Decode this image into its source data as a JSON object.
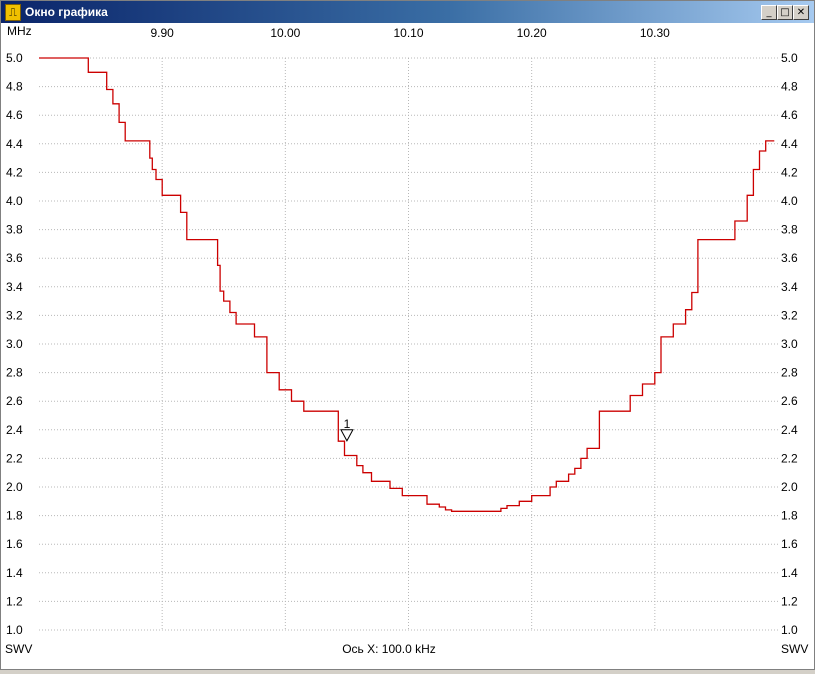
{
  "window": {
    "title": "Окно графика",
    "icon": "chart-window-icon",
    "controls": [
      "minimize",
      "maximize",
      "close"
    ]
  },
  "chart_data": {
    "type": "line",
    "title": "",
    "x_unit_label": "MHz",
    "x_ticks": [
      "9.90",
      "10.00",
      "10.10",
      "10.20",
      "10.30"
    ],
    "x_tick_values": [
      9.9,
      10.0,
      10.1,
      10.2,
      10.3
    ],
    "xlim": [
      9.8,
      10.4
    ],
    "xlabel": "Ось X: 100.0 kHz",
    "ylabel_left": "SWV",
    "ylabel_right": "SWV",
    "ylim": [
      1.0,
      5.0
    ],
    "y_ticks": [
      "5.0",
      "4.8",
      "4.6",
      "4.4",
      "4.2",
      "4.0",
      "3.8",
      "3.6",
      "3.4",
      "3.2",
      "3.0",
      "2.8",
      "2.6",
      "2.4",
      "2.2",
      "2.0",
      "1.8",
      "1.6",
      "1.4",
      "1.2",
      "1.0"
    ],
    "grid": true,
    "line_color": "#cc0000",
    "marker": {
      "label": "1",
      "x": 10.05,
      "y": 2.4
    },
    "series": [
      {
        "x": [
          9.8,
          9.84,
          9.84,
          9.855,
          9.855,
          9.86,
          9.86,
          9.865,
          9.865,
          9.87,
          9.87,
          9.875,
          9.875,
          9.88,
          9.88,
          9.89,
          9.89,
          9.892,
          9.892,
          9.895,
          9.895,
          9.9,
          9.9,
          9.915,
          9.915,
          9.92,
          9.92,
          9.925,
          9.925,
          9.945,
          9.945,
          9.947,
          9.947,
          9.95,
          9.95,
          9.955,
          9.955,
          9.96,
          9.96,
          9.965,
          9.965,
          9.975,
          9.975,
          9.985,
          9.985,
          9.995,
          9.995,
          10.005,
          10.005,
          10.015,
          10.015,
          10.025,
          10.025,
          10.043,
          10.043,
          10.048,
          10.048,
          10.058,
          10.058,
          10.063,
          10.063,
          10.07,
          10.07,
          10.085,
          10.085,
          10.095,
          10.095,
          10.098,
          10.098,
          10.115,
          10.115,
          10.125,
          10.125,
          10.13,
          10.13,
          10.135,
          10.135,
          10.175,
          10.175,
          10.18,
          10.18,
          10.19,
          10.19,
          10.2,
          10.2,
          10.215,
          10.215,
          10.22,
          10.22,
          10.23,
          10.23,
          10.235,
          10.235,
          10.24,
          10.24,
          10.245,
          10.245,
          10.255,
          10.255,
          10.275,
          10.275,
          10.28,
          10.28,
          10.29,
          10.29,
          10.3,
          10.3,
          10.305,
          10.305,
          10.315,
          10.315,
          10.325,
          10.325,
          10.33,
          10.33,
          10.335,
          10.335,
          10.36,
          10.36,
          10.365,
          10.365,
          10.375,
          10.375,
          10.38,
          10.38,
          10.385,
          10.385,
          10.39,
          10.39,
          10.397
        ],
        "y": [
          5.0,
          5.0,
          4.9,
          4.9,
          4.78,
          4.78,
          4.68,
          4.68,
          4.55,
          4.55,
          4.42,
          4.42,
          4.42,
          4.42,
          4.42,
          4.42,
          4.3,
          4.3,
          4.22,
          4.22,
          4.15,
          4.15,
          4.04,
          4.04,
          3.92,
          3.92,
          3.73,
          3.73,
          3.73,
          3.73,
          3.55,
          3.55,
          3.37,
          3.37,
          3.3,
          3.3,
          3.22,
          3.22,
          3.14,
          3.14,
          3.14,
          3.14,
          3.05,
          3.05,
          2.8,
          2.8,
          2.68,
          2.68,
          2.6,
          2.6,
          2.53,
          2.53,
          2.53,
          2.53,
          2.32,
          2.32,
          2.22,
          2.22,
          2.15,
          2.15,
          2.1,
          2.1,
          2.04,
          2.04,
          1.99,
          1.99,
          1.94,
          1.94,
          1.94,
          1.94,
          1.88,
          1.88,
          1.86,
          1.86,
          1.84,
          1.84,
          1.83,
          1.83,
          1.85,
          1.85,
          1.87,
          1.87,
          1.9,
          1.9,
          1.94,
          1.94,
          2.0,
          2.0,
          2.04,
          2.04,
          2.09,
          2.09,
          2.13,
          2.13,
          2.2,
          2.2,
          2.27,
          2.27,
          2.53,
          2.53,
          2.53,
          2.53,
          2.64,
          2.64,
          2.72,
          2.72,
          2.8,
          2.8,
          3.05,
          3.05,
          3.14,
          3.14,
          3.24,
          3.24,
          3.36,
          3.36,
          3.73,
          3.73,
          3.73,
          3.73,
          3.86,
          3.86,
          4.04,
          4.04,
          4.22,
          4.22,
          4.35,
          4.35,
          4.42,
          4.42
        ]
      }
    ]
  }
}
